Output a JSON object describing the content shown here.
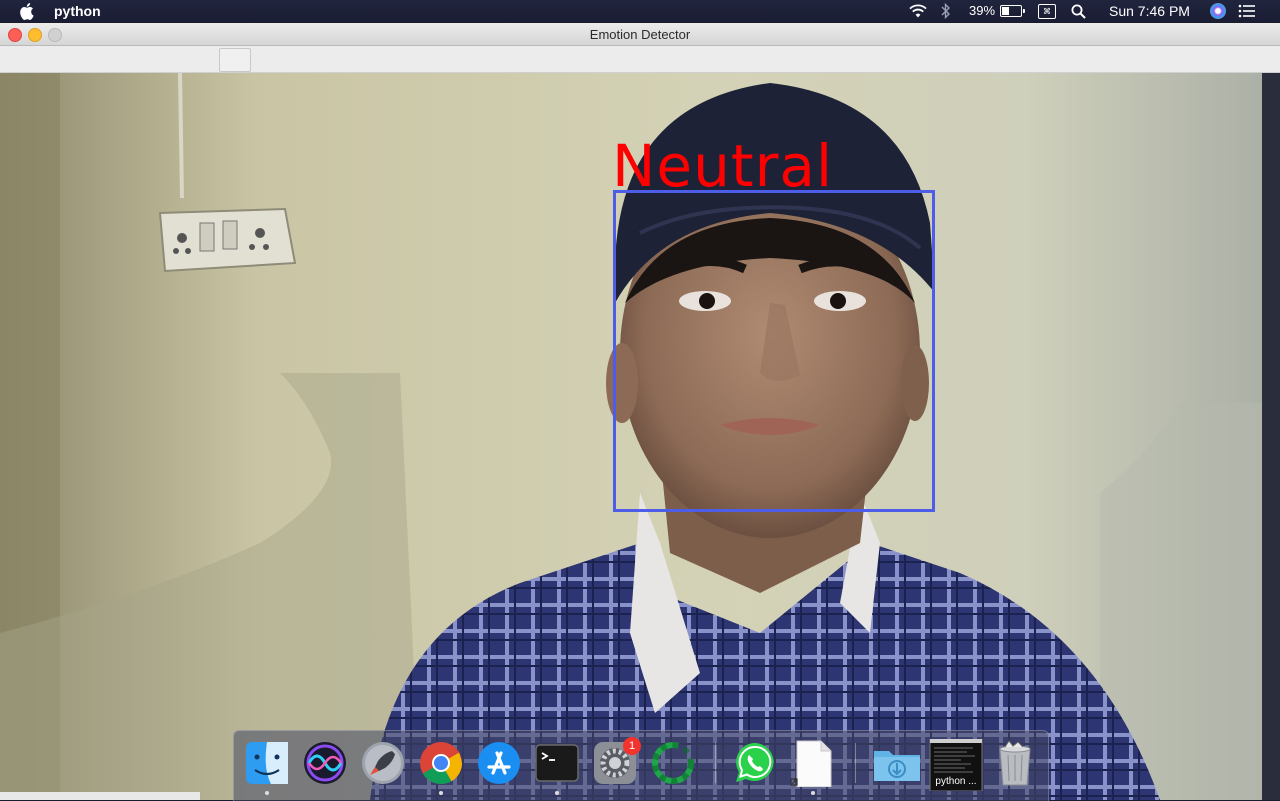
{
  "menubar": {
    "app_name": "python",
    "battery_percent": "39%",
    "battery_level": 0.39,
    "clock": "Sun 7:46 PM",
    "icons": [
      "apple-icon",
      "wifi-icon",
      "bluetooth-icon",
      "battery-icon",
      "keyboard-input-icon",
      "spotlight-icon",
      "siri-icon",
      "notification-list-icon"
    ]
  },
  "window": {
    "title": "Emotion Detector"
  },
  "detection": {
    "label": "Neutral",
    "label_color": "#ff0000",
    "box_color": "#4d5de8"
  },
  "dock": {
    "items": [
      {
        "name": "Finder",
        "icon": "finder-icon",
        "running": true
      },
      {
        "name": "Siri",
        "icon": "siri-icon",
        "running": false
      },
      {
        "name": "Launchpad",
        "icon": "rocket-icon",
        "running": false
      },
      {
        "name": "Google Chrome",
        "icon": "chrome-icon",
        "running": true
      },
      {
        "name": "App Store",
        "icon": "app-store-icon",
        "running": false
      },
      {
        "name": "Terminal",
        "icon": "terminal-icon",
        "running": true
      },
      {
        "name": "System Preferences",
        "icon": "gear-icon",
        "running": false,
        "badge": "1"
      },
      {
        "name": "Loading App",
        "icon": "ring-icon",
        "running": false
      },
      {
        "name": "WhatsApp",
        "icon": "whatsapp-icon",
        "running": false
      },
      {
        "name": "Document",
        "icon": "document-icon",
        "running": true
      },
      {
        "name": "Downloads",
        "icon": "downloads-folder-icon",
        "running": false
      },
      {
        "name": "python window",
        "icon": "window-thumbnail-icon",
        "running": false,
        "label": "python ..."
      },
      {
        "name": "Trash",
        "icon": "trash-icon",
        "running": false
      }
    ]
  }
}
